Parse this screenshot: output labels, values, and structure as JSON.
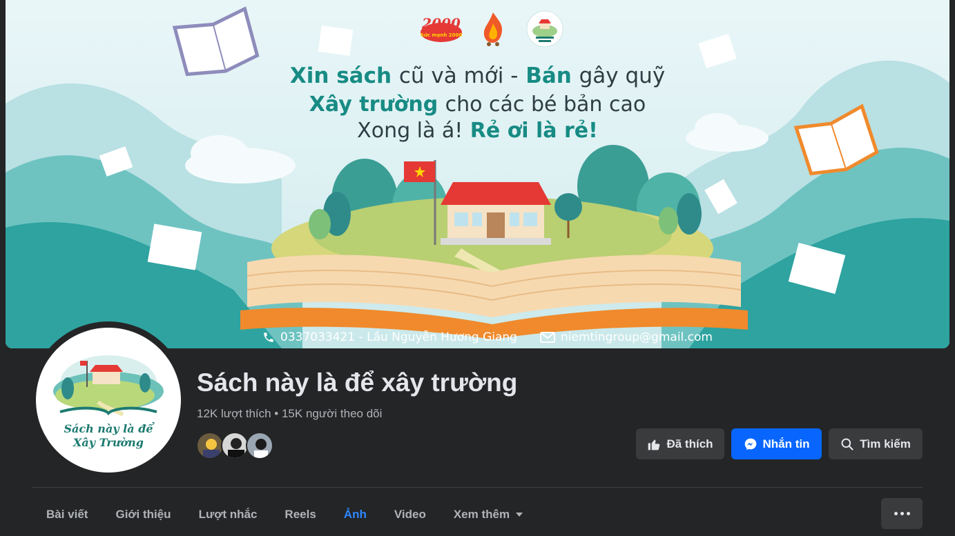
{
  "cover": {
    "line1": {
      "a": "Xin sách",
      "b": "cũ và mới -",
      "c": "Bán",
      "d": "gây quỹ"
    },
    "line2": {
      "a": "Xây trường",
      "b": "cho các bé bản cao"
    },
    "line3": {
      "a": "Xong là á!",
      "b": "Rẻ ơi là rẻ!"
    },
    "phone": "0337033421 - Lầu Nguyễn Hương Giang",
    "email": "niemtingroup@gmail.com",
    "badges": [
      "2000",
      "Sức mạnh 2000"
    ],
    "colors": {
      "accent": "#178b84",
      "cover_bg": "#dcf0f2",
      "book": "#f08a2c"
    }
  },
  "avatar": {
    "line1": "Sách này là để",
    "line2": "Xây Trường"
  },
  "page": {
    "title": "Sách này là để xây trường",
    "stats": "12K lượt thích • 15K người theo dõi"
  },
  "actions": {
    "liked": {
      "label": "Đã thích",
      "icon": "thumbs-up-icon"
    },
    "message": {
      "label": "Nhắn tin",
      "icon": "messenger-icon"
    },
    "search": {
      "label": "Tìm kiếm",
      "icon": "search-icon"
    }
  },
  "tabs": [
    {
      "label": "Bài viết"
    },
    {
      "label": "Giới thiệu"
    },
    {
      "label": "Lượt nhắc"
    },
    {
      "label": "Reels"
    },
    {
      "label": "Ảnh",
      "active": true
    },
    {
      "label": "Video"
    },
    {
      "label": "Xem thêm",
      "icon": "caret-down-icon"
    }
  ],
  "more_menu": {
    "icon": "more-horizontal-icon"
  },
  "theme": {
    "bg": "#242526",
    "button": "#3a3b3c",
    "primary": "#0866ff",
    "active_tab": "#2d88ff",
    "text": "#e4e6eb",
    "secondary_text": "#b0b3b8"
  }
}
